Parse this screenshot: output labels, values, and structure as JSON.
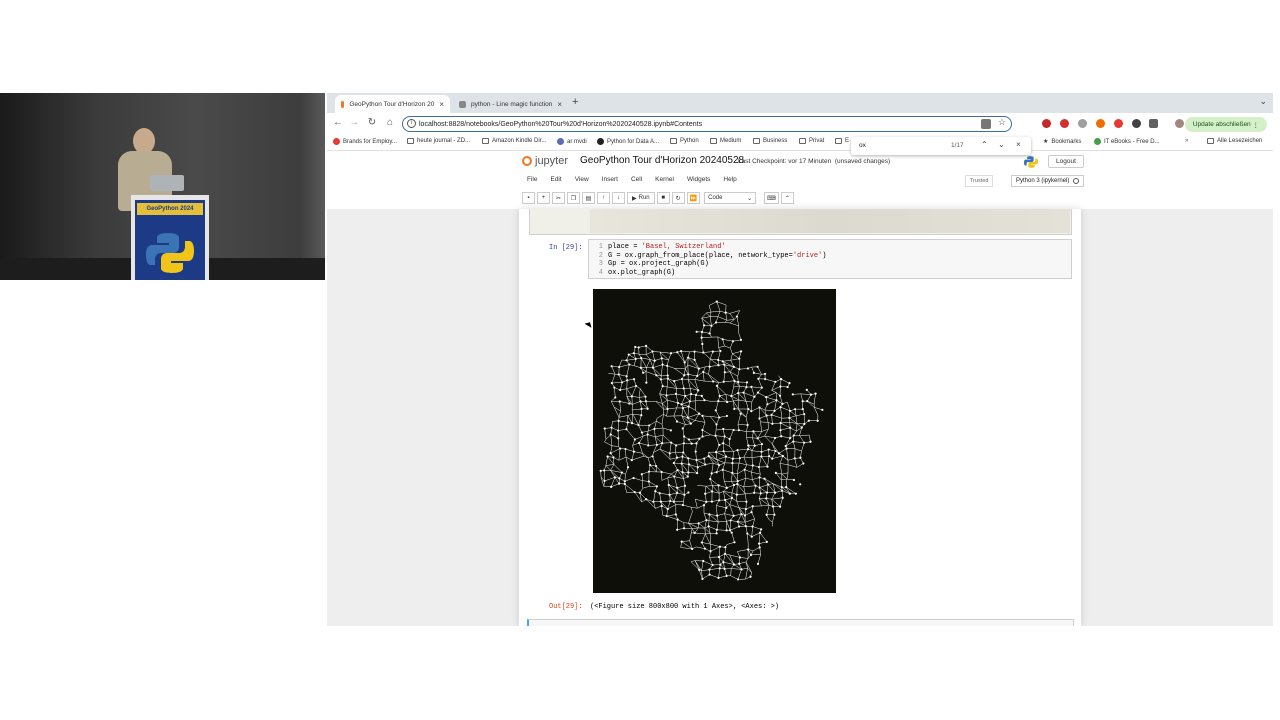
{
  "video": {
    "lectern_banner": "GeoPython 2024"
  },
  "browser": {
    "tabs": [
      {
        "title": "GeoPython Tour d'Horizon 20",
        "active": true,
        "favicon_color": "#f37626"
      },
      {
        "title": "python - Line magic function",
        "active": false,
        "favicon_color": "#888888"
      }
    ],
    "new_tab_icon": "plus-icon",
    "url": "localhost:8828/notebooks/GeoPython%20Tour%20d'Horizon%2020240528.ipynb#Contents",
    "update_button": "Update abschließen",
    "bookmarks": [
      {
        "label": "Brands for Employ...",
        "icon": "red-dot"
      },
      {
        "label": "heute journal - ZD...",
        "icon": "folder"
      },
      {
        "label": "Amazon Kindle Dir...",
        "icon": "folder"
      },
      {
        "label": "ar mvdi",
        "icon": "dot"
      },
      {
        "label": "Python for Data A...",
        "icon": "github"
      },
      {
        "label": "Python",
        "icon": "folder"
      },
      {
        "label": "Medium",
        "icon": "folder"
      },
      {
        "label": "Business",
        "icon": "folder"
      },
      {
        "label": "Privat",
        "icon": "folder"
      },
      {
        "label": "E",
        "icon": "folder"
      },
      {
        "label": "Bookmarks",
        "icon": "star"
      },
      {
        "label": "IT eBooks - Free D...",
        "icon": "green-dot"
      },
      {
        "label": "Alle Lesezeichen",
        "icon": "folder"
      }
    ],
    "find": {
      "query": "ox",
      "count": "1/17"
    }
  },
  "jupyter": {
    "logo_text": "jupyter",
    "notebook_title": "GeoPython Tour d'Horizon 20240528",
    "checkpoint": "Last Checkpoint: vor 17 Minuten",
    "unsaved": "(unsaved changes)",
    "logout": "Logout",
    "menus": [
      "File",
      "Edit",
      "View",
      "Insert",
      "Cell",
      "Kernel",
      "Widgets",
      "Help"
    ],
    "trusted": "Trusted",
    "kernel": "Python 3 (ipykernel)",
    "toolbar": {
      "run_label": "Run",
      "cell_type": "Code"
    },
    "cell": {
      "in_prompt": "In [29]:",
      "lines": [
        {
          "n": "1",
          "pre": "place = ",
          "str": "'Basel, Switzerland'",
          "post": ""
        },
        {
          "n": "2",
          "pre": "G = ox.graph_from_place(place, network_type=",
          "str": "'drive'",
          "post": ")"
        },
        {
          "n": "3",
          "pre": "Gp = ox.project_graph(G)",
          "str": "",
          "post": ""
        },
        {
          "n": "4",
          "pre": "ox.plot_graph(G)",
          "str": "",
          "post": ""
        }
      ],
      "out_prompt": "Out[29]:",
      "out_text": "(<Figure size 800x800 with 1 Axes>, <Axes: >)"
    },
    "plot": {
      "background": "#0f0f0a",
      "edge_color": "#ffffff"
    }
  }
}
